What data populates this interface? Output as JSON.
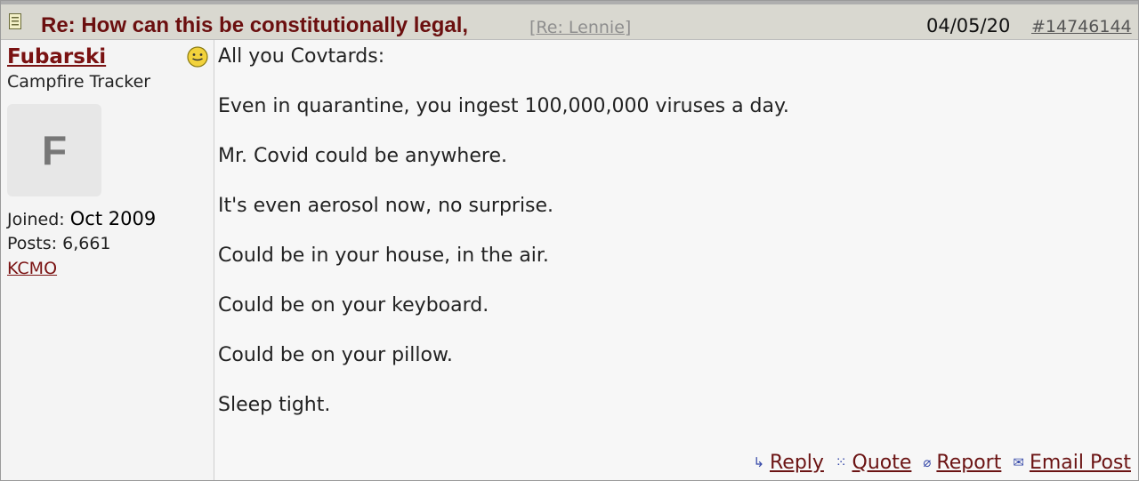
{
  "post": {
    "subject": "Re: How can this be constitutionally legal,",
    "reply_to": "[Re: Lennie]",
    "date": "04/05/20",
    "number": "#14746144"
  },
  "author": {
    "username": "Fubarski",
    "title": "Campfire Tracker",
    "avatar_initial": "F",
    "joined_label": "Joined:",
    "joined_value": "Oct 2009",
    "posts_label": "Posts:",
    "posts_value": "6,661",
    "location": "KCMO"
  },
  "body": {
    "lines": [
      "All you Covtards:",
      "Even in quarantine, you ingest 100,000,000 viruses a day.",
      "Mr. Covid could be anywhere.",
      "It's even aerosol now, no surprise.",
      "Could be in your house, in the air.",
      "Could be on your keyboard.",
      "Could be on your pillow.",
      "Sleep tight."
    ]
  },
  "actions": {
    "reply": "Reply",
    "quote": "Quote",
    "report": "Report",
    "email": "Email Post"
  },
  "icons": {
    "header": "post-icon",
    "mood": "smiley-icon",
    "reply": "reply-arrow-icon",
    "quote": "quote-icon",
    "report": "report-icon",
    "email": "email-icon"
  }
}
